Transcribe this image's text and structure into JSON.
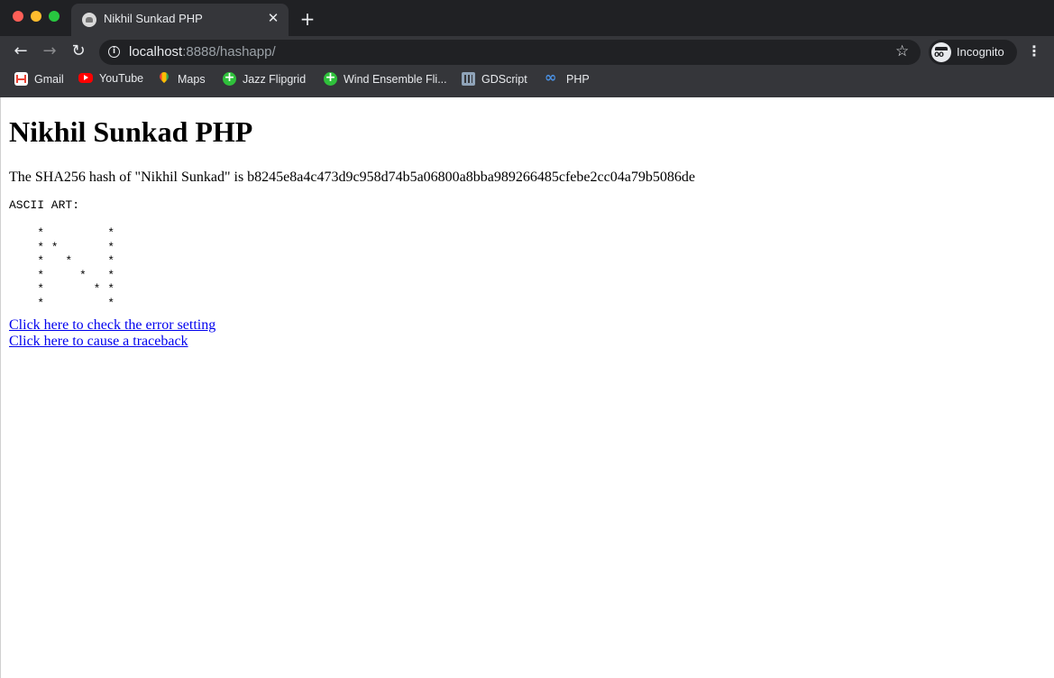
{
  "browser": {
    "tab_title": "Nikhil Sunkad PHP",
    "tab_close": "✕",
    "new_tab": "+",
    "url_host": "localhost",
    "url_rest": ":8888/hashapp/",
    "profile_label": "Incognito",
    "nav": {
      "back": "←",
      "forward": "→",
      "reload": "↻",
      "star": "☆",
      "menu": "⋮",
      "info": "i"
    },
    "bookmarks": [
      {
        "label": "Gmail",
        "icon": "gmail-icon"
      },
      {
        "label": "YouTube",
        "icon": "youtube-icon"
      },
      {
        "label": "Maps",
        "icon": "maps-icon"
      },
      {
        "label": "Jazz Flipgrid",
        "icon": "flipgrid-icon"
      },
      {
        "label": "Wind Ensemble Fli...",
        "icon": "flipgrid-icon"
      },
      {
        "label": "GDScript",
        "icon": "docs-icon"
      },
      {
        "label": "PHP",
        "icon": "link-icon"
      }
    ]
  },
  "page": {
    "heading": "Nikhil Sunkad PHP",
    "hash_line": "The SHA256 hash of \"Nikhil Sunkad\" is b8245e8a4c473d9c958d74b5a06800a8bba989266485cfebe2cc04a79b5086de",
    "ascii_art": "ASCII ART:\n\n    *         *\n    * *       *\n    *   *     *\n    *     *   *\n    *       * *\n    *         *",
    "links": [
      "Click here to check the error setting",
      "Click here to cause a traceback"
    ]
  }
}
